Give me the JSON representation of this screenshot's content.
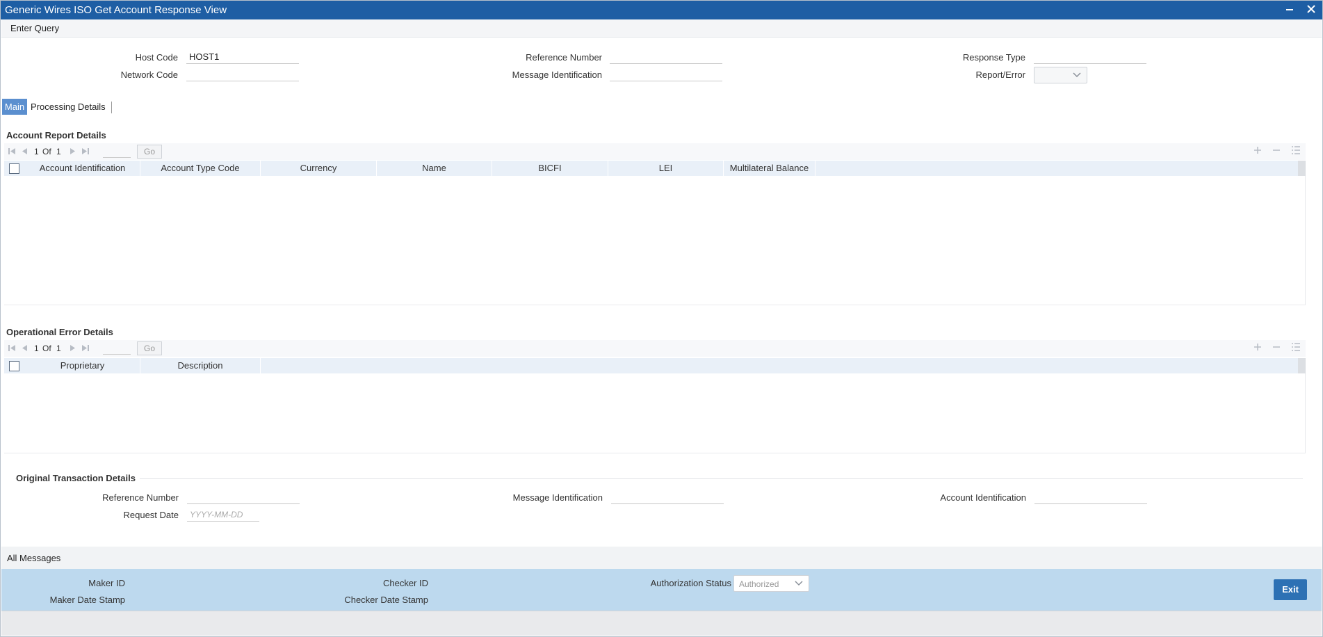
{
  "window": {
    "title": "Generic Wires ISO Get Account Response View",
    "minimize_icon": "minimize-icon",
    "close_icon": "close-icon"
  },
  "toolbar": {
    "enter_query": "Enter Query"
  },
  "header": {
    "host_code_label": "Host Code",
    "host_code_value": "HOST1",
    "network_code_label": "Network Code",
    "network_code_value": "",
    "reference_number_label": "Reference Number",
    "reference_number_value": "",
    "message_identification_label": "Message Identification",
    "message_identification_value": "",
    "response_type_label": "Response Type",
    "response_type_value": "",
    "report_error_label": "Report/Error",
    "report_error_value": ""
  },
  "tabs": [
    {
      "label": "Main",
      "active": true
    },
    {
      "label": "Processing Details",
      "active": false
    }
  ],
  "account_report": {
    "title": "Account Report Details",
    "pagination": {
      "current": "1",
      "of_label": "Of",
      "total": "1",
      "go_label": "Go"
    },
    "columns": [
      "Account Identification",
      "Account Type Code",
      "Currency",
      "Name",
      "BICFI",
      "LEI",
      "Multilateral Balance"
    ],
    "rows": []
  },
  "operational_error": {
    "title": "Operational Error Details",
    "pagination": {
      "current": "1",
      "of_label": "Of",
      "total": "1",
      "go_label": "Go"
    },
    "columns": [
      "Proprietary",
      "Description"
    ],
    "rows": []
  },
  "original_transaction": {
    "title": "Original Transaction Details",
    "reference_number_label": "Reference Number",
    "reference_number_value": "",
    "message_identification_label": "Message Identification",
    "message_identification_value": "",
    "account_identification_label": "Account Identification",
    "account_identification_value": "",
    "request_date_label": "Request Date",
    "request_date_placeholder": "YYYY-MM-DD"
  },
  "all_messages": {
    "label": "All Messages"
  },
  "footer": {
    "maker_id_label": "Maker ID",
    "maker_date_stamp_label": "Maker Date Stamp",
    "checker_id_label": "Checker ID",
    "checker_date_stamp_label": "Checker Date Stamp",
    "authorization_status_label": "Authorization Status",
    "authorization_status_value": "Authorized",
    "exit_label": "Exit"
  },
  "colors": {
    "title_bar": "#1e5ea4",
    "active_tab": "#5b8fcf",
    "grid_header": "#e9f0f8",
    "footer": "#bdd9ee",
    "exit_button": "#2d71b4"
  }
}
